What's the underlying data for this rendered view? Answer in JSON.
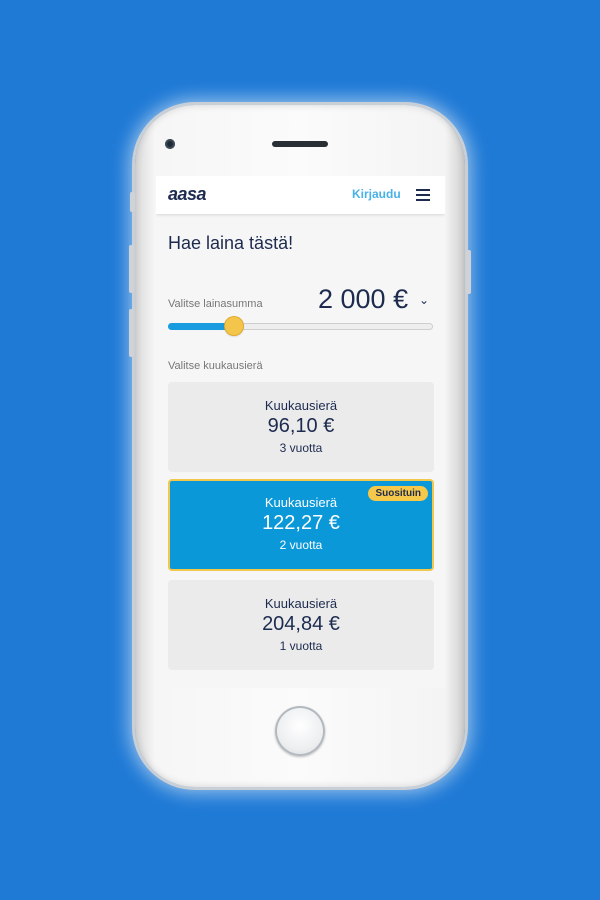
{
  "colors": {
    "background": "#1f7ad6",
    "brand_navy": "#1d2b4f",
    "accent_blue": "#0a98d9",
    "login_blue": "#48b2e6",
    "highlight_yellow": "#f5c84a"
  },
  "header": {
    "logo": "aasa",
    "login_label": "Kirjaudu",
    "menu_icon": "hamburger-menu-icon"
  },
  "page": {
    "title": "Hae laina tästä!",
    "amount_label": "Valitse lainasumma",
    "amount_value": "2 000 €",
    "amount_chevron": "⌄",
    "slider_level": 0.25,
    "installment_label": "Valitse kuukausierä"
  },
  "options": [
    {
      "label": "Kuukausierä",
      "value": "96,10 €",
      "term": "3 vuotta"
    },
    {
      "label": "Kuukausierä",
      "value": "122,27 €",
      "term": "2 vuotta",
      "badge": "Suosituin",
      "selected": true
    },
    {
      "label": "Kuukausierä",
      "value": "204,84 €",
      "term": "1 vuotta"
    }
  ]
}
